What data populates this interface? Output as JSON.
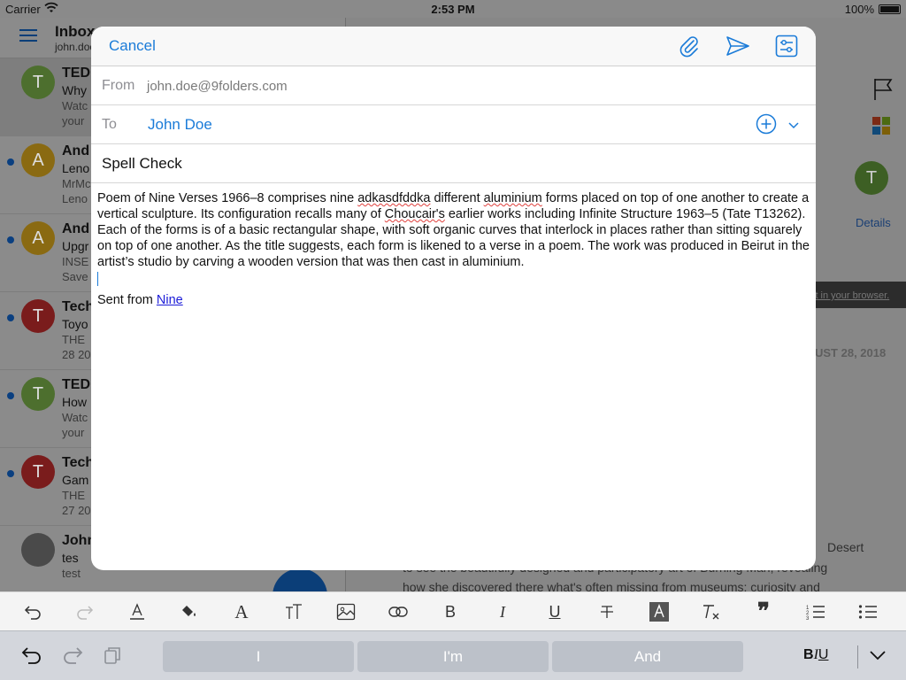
{
  "status_bar": {
    "carrier": "Carrier",
    "time": "2:53 PM",
    "battery": "100%"
  },
  "mail_list": {
    "title": "Inbox",
    "account": "john.doe",
    "items": [
      {
        "avatar": "T",
        "avatar_color": "#4d6f2e",
        "line1": "TED",
        "line2": "Why",
        "line3": "Watc",
        "line4": "your",
        "unread": false,
        "selected": true
      },
      {
        "avatar": "A",
        "avatar_color": "#8a6a12",
        "line1": "And",
        "line2": "Leno",
        "line3": "MrMc",
        "line4": "Leno",
        "unread": true,
        "selected": false
      },
      {
        "avatar": "A",
        "avatar_color": "#8a6a12",
        "line1": "And",
        "line2": "Upgr",
        "line3": "INSE",
        "line4": "Save",
        "unread": true,
        "selected": false
      },
      {
        "avatar": "T",
        "avatar_color": "#7a1c1c",
        "line1": "Tech",
        "line2": "Toyo",
        "line3": "THE",
        "line4": "28 20",
        "unread": true,
        "selected": false
      },
      {
        "avatar": "T",
        "avatar_color": "#4d6f2e",
        "line1": "TED",
        "line2": "How",
        "line3": "Watc",
        "line4": "your",
        "unread": true,
        "selected": false
      },
      {
        "avatar": "T",
        "avatar_color": "#7a1c1c",
        "line1": "Tech",
        "line2": "Gam",
        "line3": "THE",
        "line4": "27 20",
        "unread": true,
        "selected": false
      },
      {
        "avatar": "",
        "avatar_color": "#4a4a4a",
        "line1": "John",
        "line2": "tes",
        "line3": "test",
        "line4": "",
        "unread": false,
        "selected": false
      }
    ]
  },
  "detail": {
    "avatar": "T",
    "details_label": "Details",
    "browser_text": "it in your browser.",
    "date_text": "UST 28, 2018",
    "desert_text": "Desert",
    "body_line1": "to see the beautifully designed and participatory art of Burning Man, revealing",
    "body_line2": "how she discovered there what's often missing from museums: curiosity and"
  },
  "compose": {
    "cancel_label": "Cancel",
    "from_label": "From",
    "from_value": "john.doe@9folders.com",
    "to_label": "To",
    "to_value": "John Doe",
    "subject": "Spell Check",
    "body_parts": [
      "Poem of Nine Verses 1966–8 comprises nine ",
      "adkasdfddka",
      " different ",
      "aluminium",
      " forms placed on top of one another to create a vertical sculpture. Its configuration recalls many of ",
      "Choucair's",
      " earlier works including Infinite Structure 1963–5 (Tate T13262). Each of the forms is of a basic rectangular shape, with soft organic curves that interlock in places rather than sitting squarely on top of one another. As the title suggests, each form is likened to a verse in a poem. The work was produced in Beirut in the artist’s studio by carving a wooden version that was then cast in aluminium."
    ],
    "signature_prefix": "Sent from ",
    "signature_link": "Nine"
  },
  "format_toolbar": {
    "bold": "B",
    "italic": "I",
    "underline": "U"
  },
  "keyboard": {
    "suggestions": [
      "I",
      "I'm",
      "And"
    ],
    "biu_b": "B",
    "biu_i": "I",
    "biu_u": "U"
  },
  "colors": {
    "accent": "#1a7bd8",
    "link": "#1b1bd8",
    "misspelled": "#e0403c"
  }
}
